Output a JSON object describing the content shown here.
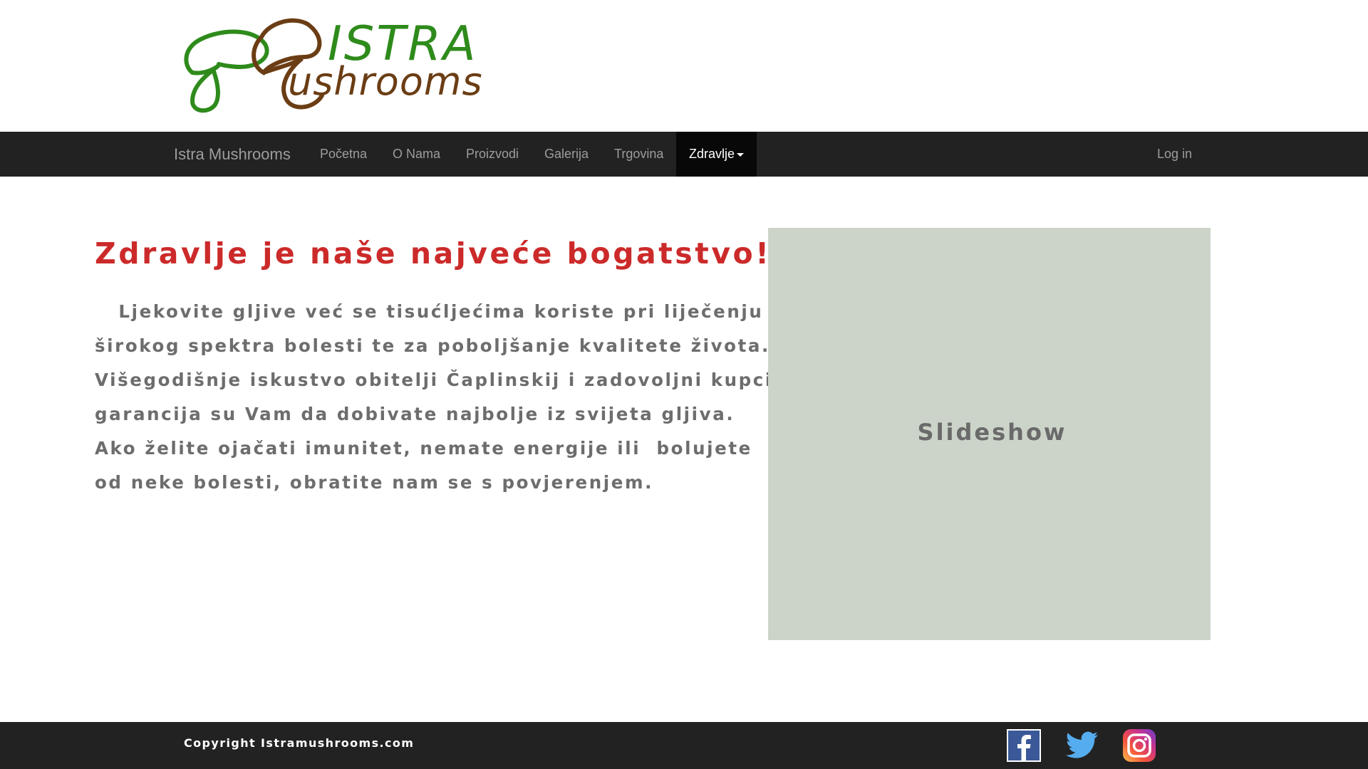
{
  "logo": {
    "word1": "ISTRA",
    "word2": "ushrooms",
    "colors": {
      "green": "#2e8b1b",
      "brown": "#6b3d14"
    }
  },
  "navbar": {
    "brand": "Istra Mushrooms",
    "items": [
      {
        "label": "Početna"
      },
      {
        "label": "O Nama"
      },
      {
        "label": "Proizvodi"
      },
      {
        "label": "Galerija"
      },
      {
        "label": "Trgovina"
      },
      {
        "label": "Zdravlje",
        "active": true,
        "dropdown": true
      }
    ],
    "login": "Log in"
  },
  "main": {
    "headline": "Zdravlje je naše najveće bogatstvo!",
    "paragraph_lines": [
      "   Ljekovite gljive već se tisućljećima koriste pri liječenju",
      "širokog spektra bolesti te za poboljšanje kvalitete života.",
      "Višegodišnje iskustvo obitelji Čaplinskij i zadovoljni kupci",
      "garancija su Vam da dobivate najbolje iz svijeta gljiva.",
      "Ako želite ojačati imunitet, nemate energije ili  bolujete",
      "od neke bolesti, obratite nam se s povjerenjem."
    ],
    "slideshow_label": "Slideshow"
  },
  "footer": {
    "copyright": "Copyright Istramushrooms.com",
    "social": [
      "facebook-icon",
      "twitter-icon",
      "instagram-icon"
    ]
  },
  "colors": {
    "navbar_bg": "#222222",
    "active_tab_bg": "#080808",
    "headline": "#cc2a2a",
    "body_text": "#6d6d6d",
    "slideshow_bg": "#ccd4c9",
    "footer_bg": "#222222"
  }
}
